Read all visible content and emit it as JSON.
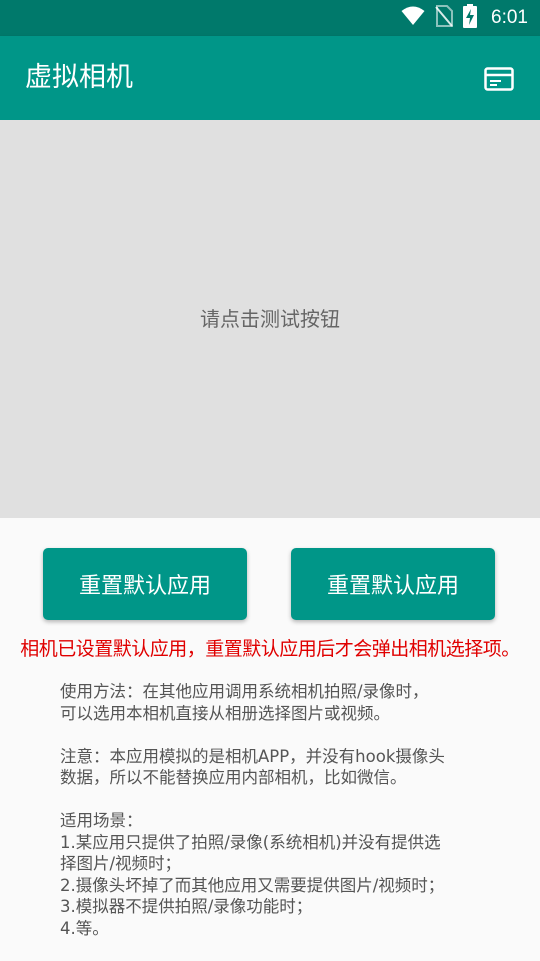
{
  "status_bar": {
    "time": "6:01",
    "icons": [
      "wifi-icon",
      "no-sim-icon",
      "battery-charging-icon"
    ]
  },
  "app_bar": {
    "title": "虚拟相机",
    "action_icon": "card-icon"
  },
  "preview": {
    "message": "请点击测试按钮"
  },
  "buttons": {
    "left_label": "重置默认应用",
    "right_label": "重置默认应用"
  },
  "warning": "相机已设置默认应用，重置默认应用后才会弹出相机选择项。",
  "instructions": {
    "usage": [
      "使用方法：在其他应用调用系统相机拍照/录像时，",
      "可以选用本相机直接从相册选择图片或视频。"
    ],
    "note": [
      "注意：本应用模拟的是相机APP，并没有hook摄像头",
      "数据，所以不能替换应用内部相机，比如微信。"
    ],
    "scenarios": [
      "适用场景：",
      "1.某应用只提供了拍照/录像(系统相机)并没有提供选",
      "择图片/视频时；",
      "2.摄像头坏掉了而其他应用又需要提供图片/视频时；",
      "3.模拟器不提供拍照/录像功能时；",
      "4.等。"
    ]
  },
  "colors": {
    "status_bar": "#00796b",
    "app_bar": "#009688",
    "preview_bg": "#e0e0e0",
    "button": "#009688",
    "warning_text": "#e00000"
  }
}
